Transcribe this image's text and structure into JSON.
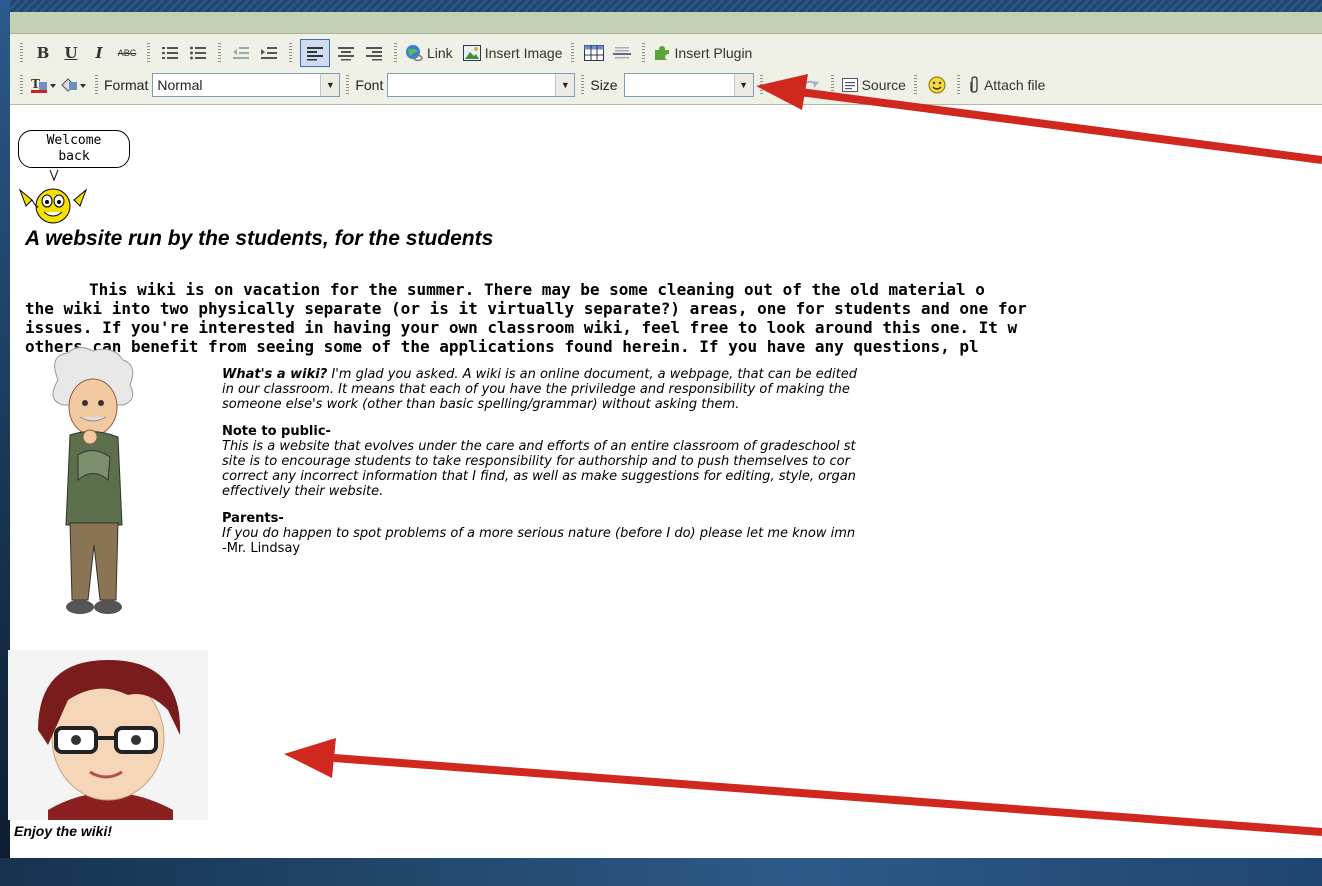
{
  "toolbar": {
    "row1": {
      "bold": "B",
      "underline": "U",
      "italic": "I",
      "strike": "ABC",
      "link_label": "Link",
      "insert_image_label": "Insert Image",
      "insert_plugin_label": "Insert Plugin"
    },
    "row2": {
      "format_label": "Format",
      "format_value": "Normal",
      "font_label": "Font",
      "font_value": "",
      "size_label": "Size",
      "size_value": "",
      "source_label": "Source",
      "attach_label": "Attach file"
    }
  },
  "content": {
    "speech_line1": "Welcome",
    "speech_line2": "back",
    "heading": "A website run by the students, for the students",
    "intro_line1": "This wiki is on vacation for the summer. There may be some cleaning out of the old material o",
    "intro_line2": "the wiki into two physically separate (or is it virtually separate?) areas, one for students and one for",
    "intro_line3": "issues. If you're interested in having your own classroom wiki, feel free to look around this one. It w",
    "intro_line4": "others can benefit from seeing some of the applications found herein. If you have any questions, pl",
    "whats_wiki_bold": "What's a wiki?",
    "whats_wiki_line1": " I'm glad you asked. A wiki is an online document, a webpage, that can be edited",
    "whats_wiki_line2": "in our classroom. It means that each of you have the priviledge and responsibility of making the",
    "whats_wiki_line3": "someone else's work (other than basic spelling/grammar) without asking them.",
    "public_heading": "Note to public-",
    "public_line1": "This is a website that evolves under the care and efforts of an entire classroom of gradeschool st",
    "public_line2": "site is to encourage students to take responsibility for authorship and to push themselves to cor",
    "public_line3": "correct any incorrect information that I find, as well as make suggestions for editing, style, organ",
    "public_line4": "effectively their website.",
    "parents_heading": "Parents-",
    "parents_line1": "If you do happen to spot problems of a more serious nature (before I do) please let me know imn",
    "signature": "-Mr. Lindsay",
    "enjoy": "Enjoy the wiki!"
  },
  "colors": {
    "titlebar": "#c3d0b4",
    "toolbar_bg": "#eff0e6",
    "arrow": "#d0281e",
    "frame": "#1d3f66"
  }
}
